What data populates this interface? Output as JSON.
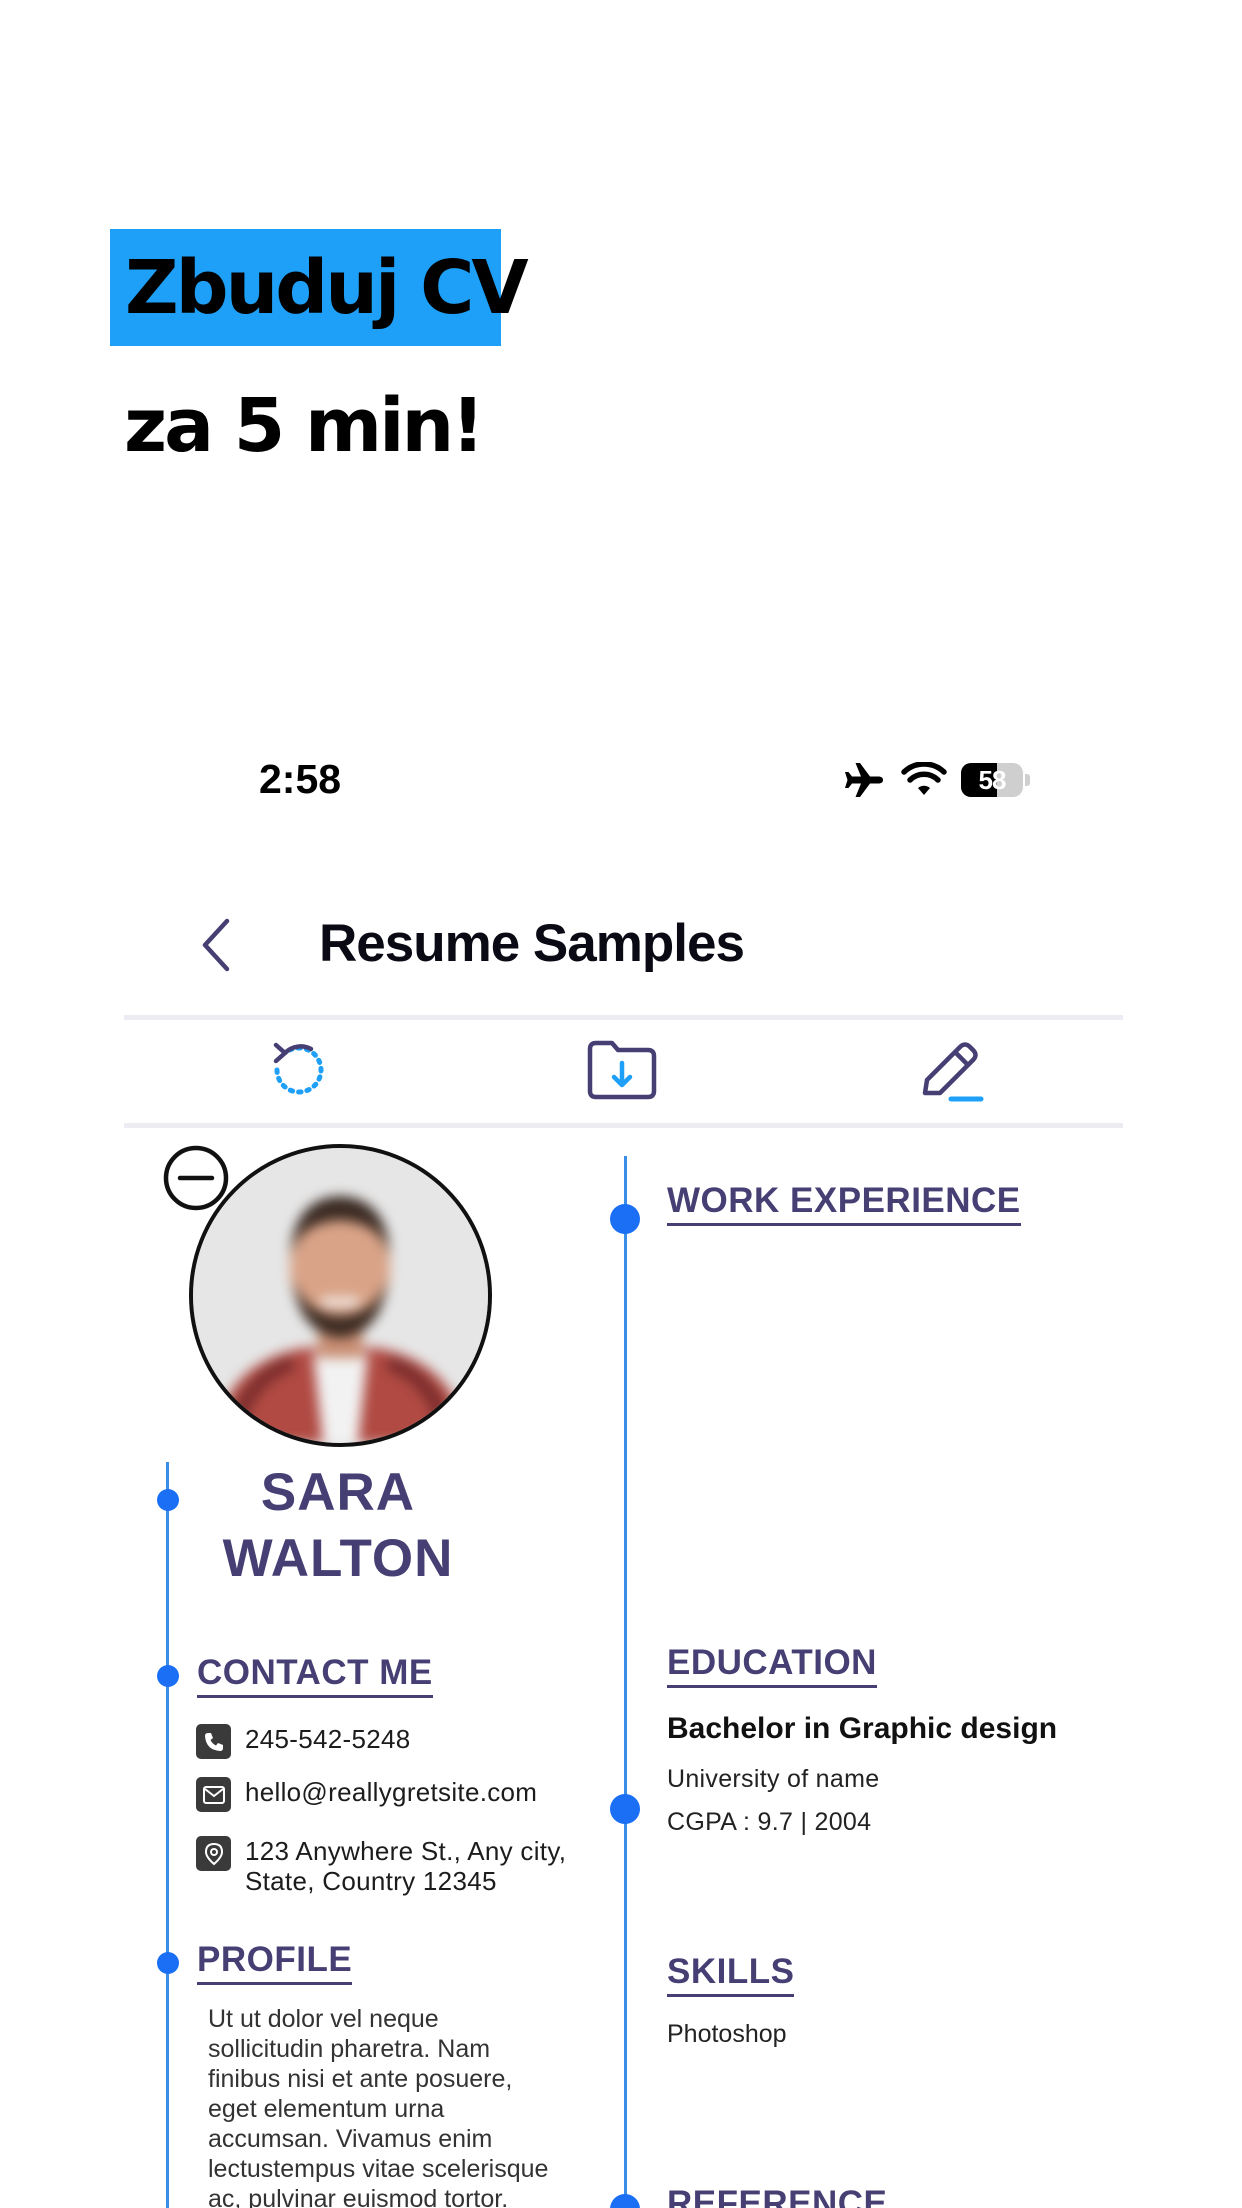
{
  "promo": {
    "line1": "Zbuduj CV",
    "line2": "za 5 min!"
  },
  "status_bar": {
    "time": "2:58",
    "battery": "58",
    "battery_level": 0.58,
    "icons": [
      "airplane-icon",
      "wifi-icon",
      "battery-icon"
    ]
  },
  "nav": {
    "title": "Resume Samples",
    "back_icon": "chevron-left-icon"
  },
  "toolbar": {
    "icons": [
      "reset-icon",
      "download-folder-icon",
      "edit-pencil-icon"
    ]
  },
  "resume": {
    "first_name": "SARA",
    "last_name": "WALTON",
    "contact": {
      "title": "CONTACT ME",
      "phone": "245-542-5248",
      "email": "hello@reallygretsite.com",
      "address": "123 Anywhere St., Any city,\nState, Country 12345"
    },
    "profile": {
      "title": "PROFILE",
      "text": "Ut ut dolor vel neque\nsollicitudin pharetra. Nam\nfinibus nisi et ante posuere,\neget elementum urna\naccumsan. Vivamus enim\nlectustempus vitae scelerisque\nac, pulvinar euismod tortor."
    },
    "work_experience": {
      "title": "WORK EXPERIENCE"
    },
    "education": {
      "title": "EDUCATION",
      "degree": "Bachelor in Graphic design",
      "school": "University of name",
      "cgpa": "CGPA : 9.7 | 2004"
    },
    "skills": {
      "title": "SKILLS",
      "items": [
        "Photoshop"
      ]
    },
    "reference": {
      "title": "REFERENCE"
    }
  },
  "colors": {
    "accent": "#1ea0f8",
    "timeline": "#3b8ee8",
    "dot": "#1a6ff5",
    "heading": "#453f74"
  }
}
